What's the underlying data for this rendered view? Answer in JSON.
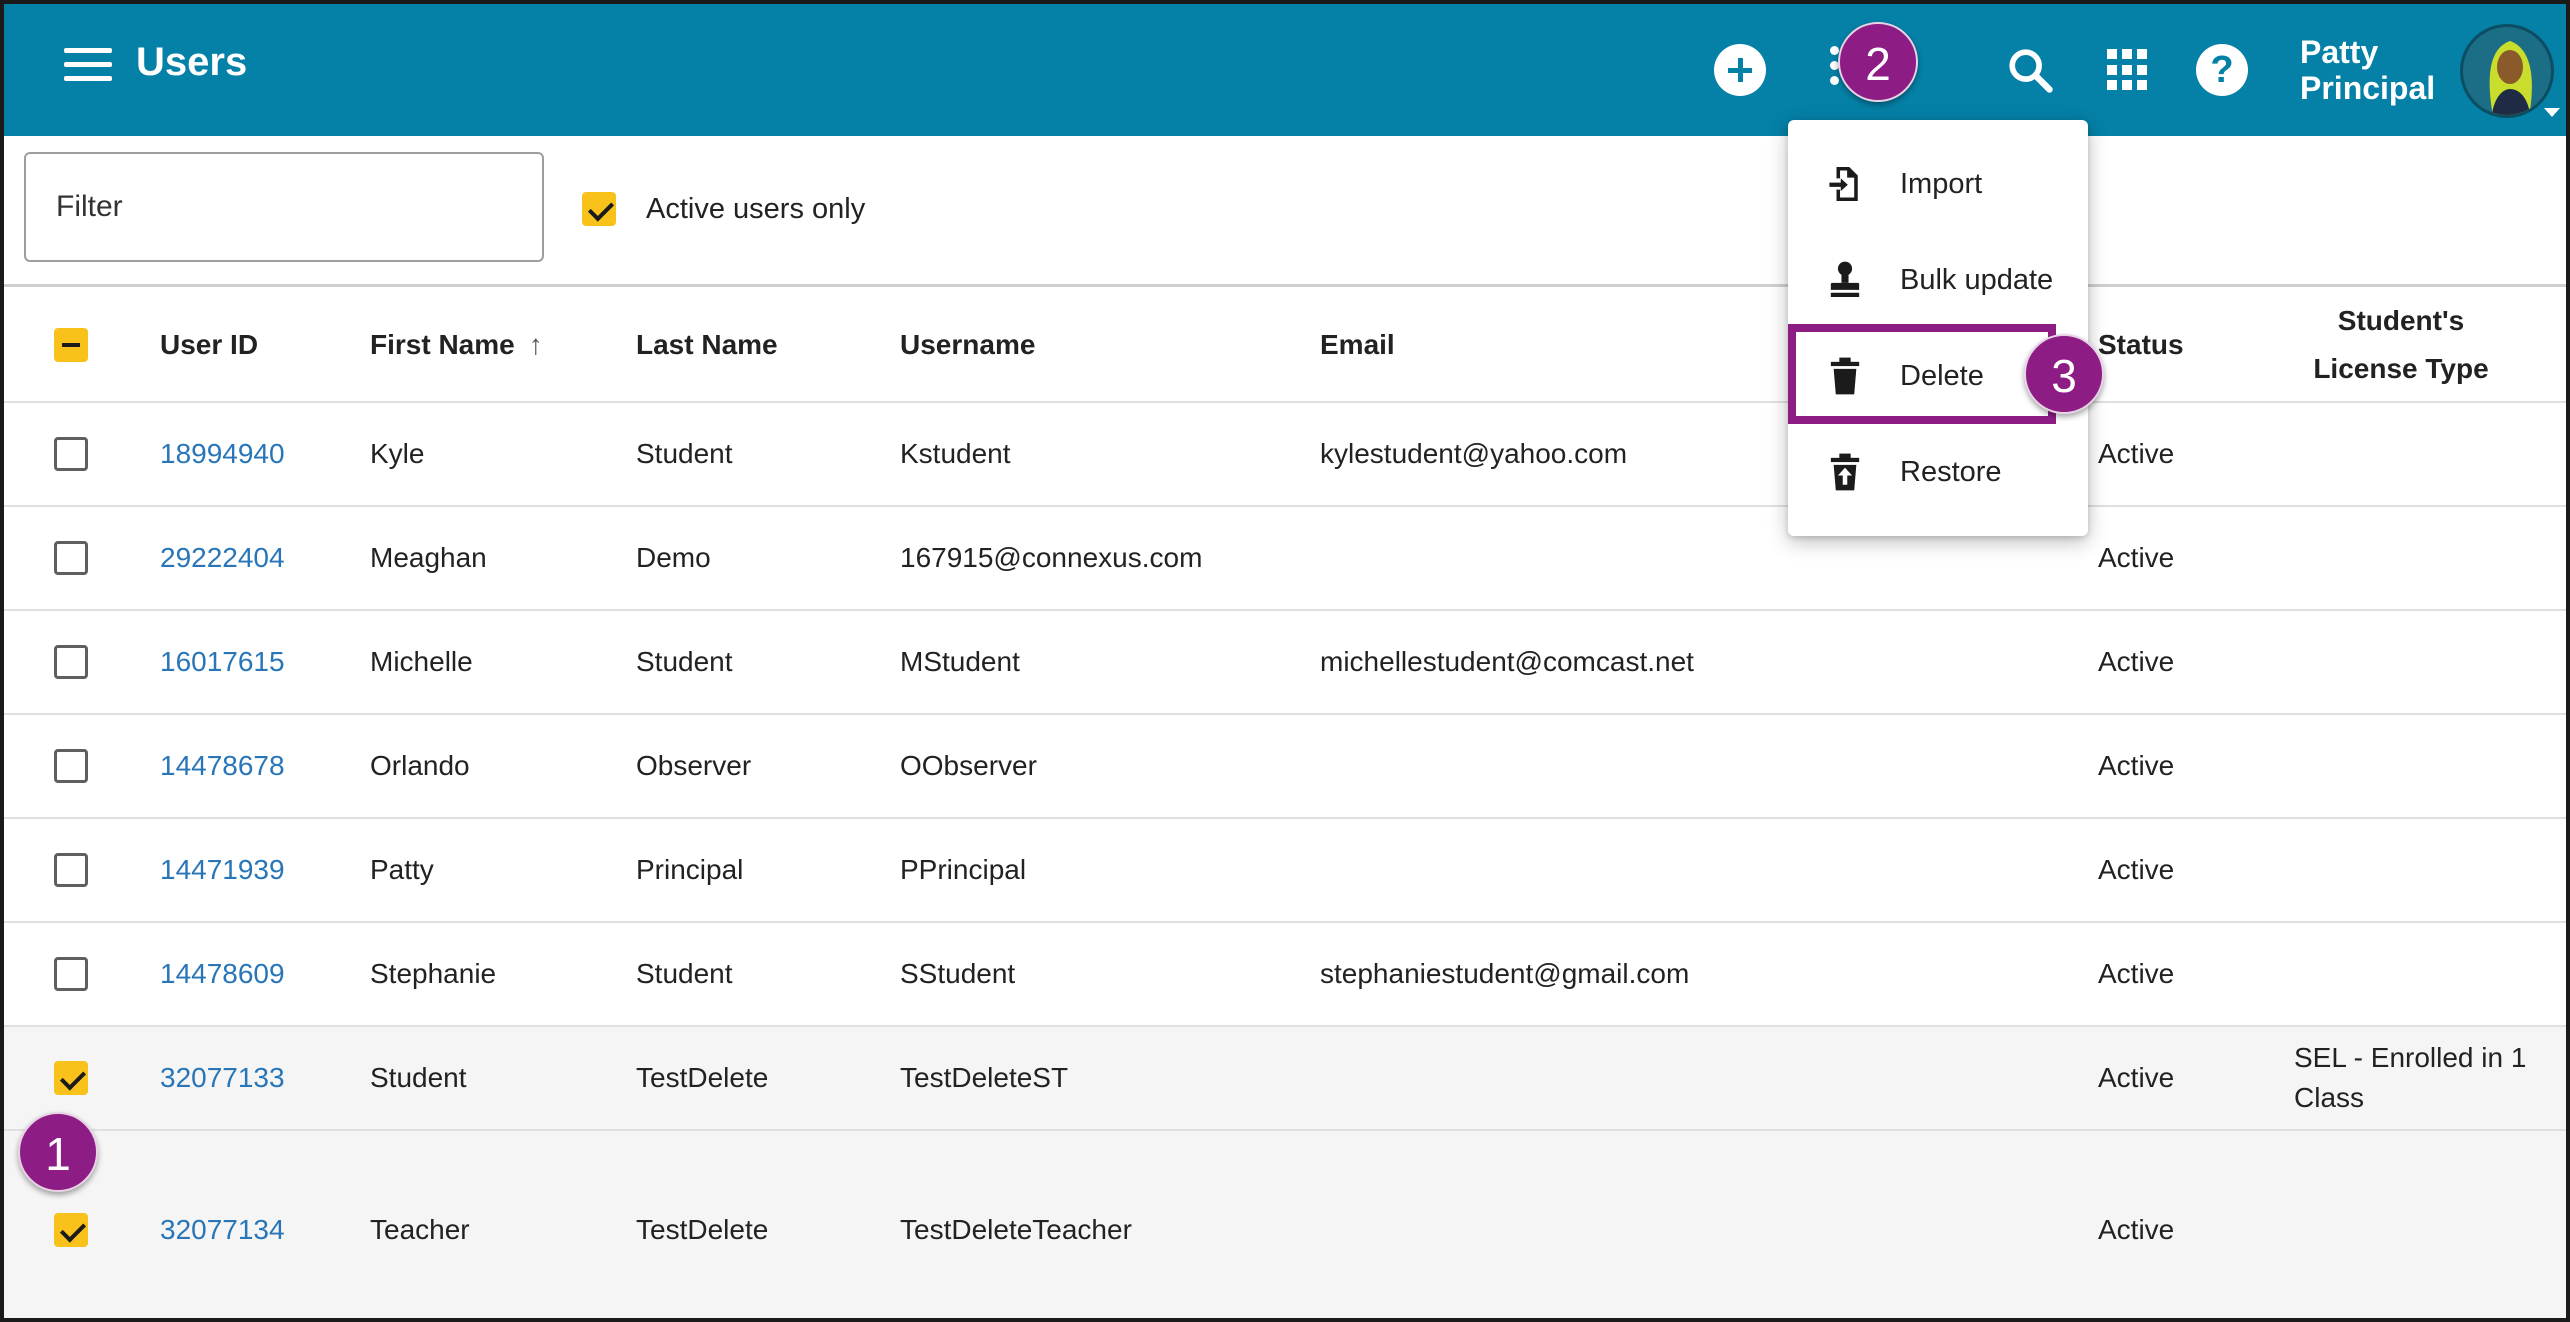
{
  "header": {
    "title": "Users",
    "user_name_line1": "Patty",
    "user_name_line2": "Principal",
    "icons": [
      "menu-icon",
      "add-circle-icon",
      "more-vert-icon",
      "search-icon",
      "apps-grid-icon",
      "help-icon"
    ]
  },
  "filter": {
    "placeholder": "Filter",
    "active_only_label": "Active users only",
    "active_only_checked": true
  },
  "table": {
    "columns": {
      "user_id": "User ID",
      "first_name": "First Name",
      "last_name": "Last Name",
      "username": "Username",
      "email": "Email",
      "status": "Status",
      "license_line1": "Student's",
      "license_line2": "License Type"
    },
    "sort": {
      "column": "First Name",
      "direction": "ascending"
    },
    "rows": [
      {
        "selected": false,
        "user_id": "18994940",
        "first": "Kyle",
        "last": "Student",
        "username": "Kstudent",
        "email": "kylestudent@yahoo.com",
        "status": "Active",
        "license": ""
      },
      {
        "selected": false,
        "user_id": "29222404",
        "first": "Meaghan",
        "last": "Demo",
        "username": "167915@connexus.com",
        "email": "",
        "status": "Active",
        "license": ""
      },
      {
        "selected": false,
        "user_id": "16017615",
        "first": "Michelle",
        "last": "Student",
        "username": "MStudent",
        "email": "michellestudent@comcast.net",
        "status": "Active",
        "license": ""
      },
      {
        "selected": false,
        "user_id": "14478678",
        "first": "Orlando",
        "last": "Observer",
        "username": "OObserver",
        "email": "",
        "status": "Active",
        "license": ""
      },
      {
        "selected": false,
        "user_id": "14471939",
        "first": "Patty",
        "last": "Principal",
        "username": "PPrincipal",
        "email": "",
        "status": "Active",
        "license": ""
      },
      {
        "selected": false,
        "user_id": "14478609",
        "first": "Stephanie",
        "last": "Student",
        "username": "SStudent",
        "email": "stephaniestudent@gmail.com",
        "status": "Active",
        "license": ""
      },
      {
        "selected": true,
        "user_id": "32077133",
        "first": "Student",
        "last": "TestDelete",
        "username": "TestDeleteST",
        "email": "",
        "status": "Active",
        "license": "SEL - Enrolled in 1 Class"
      },
      {
        "selected": true,
        "user_id": "32077134",
        "first": "Teacher",
        "last": "TestDelete",
        "username": "TestDeleteTeacher",
        "email": "",
        "status": "Active",
        "license": ""
      }
    ]
  },
  "menu": {
    "items": [
      {
        "label": "Import",
        "icon": "import-file-icon"
      },
      {
        "label": "Bulk update",
        "icon": "stamp-icon"
      },
      {
        "label": "Delete",
        "icon": "trash-icon",
        "highlighted": true
      },
      {
        "label": "Restore",
        "icon": "restore-trash-icon"
      }
    ]
  },
  "steps": {
    "one": "1",
    "two": "2",
    "three": "3"
  },
  "colors": {
    "appbar": "#0580a6",
    "accent_checkbox": "#f9c21b",
    "link": "#2876b8",
    "step_badge": "#8d1d85"
  }
}
